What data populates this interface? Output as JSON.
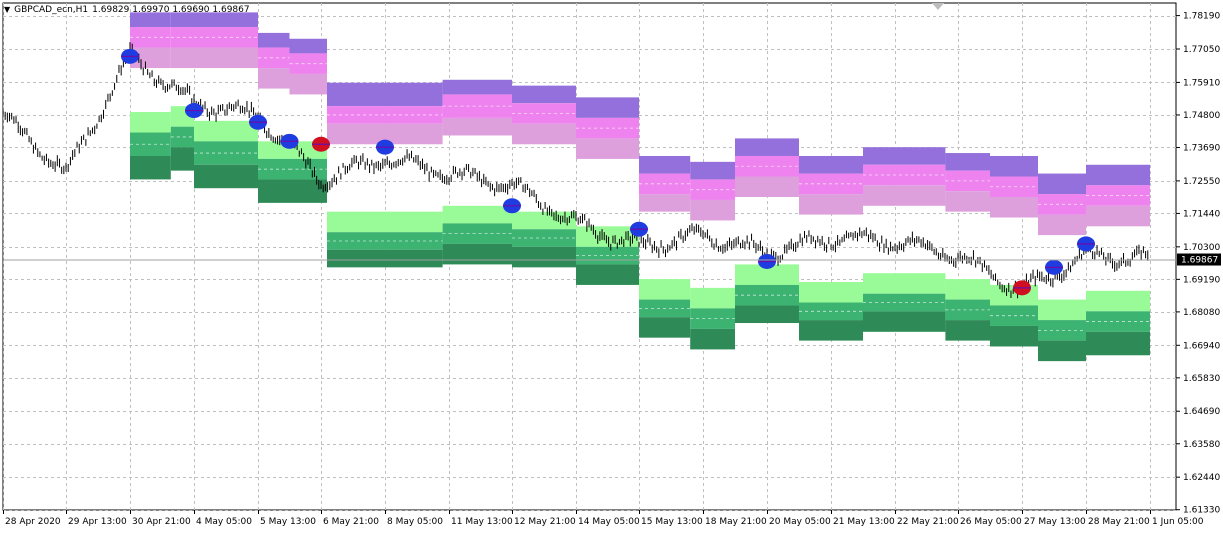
{
  "header": {
    "symbol": "GBPCAD_ecn,H1",
    "ohlc": "1.69829 1.69970 1.69690 1.69867",
    "menu_icon": "triangle-down-icon"
  },
  "chart_data": {
    "type": "candlestick",
    "symbol": "GBPCAD_ecn",
    "timeframe": "H1",
    "ylim": [
      1.6132,
      1.7862
    ],
    "y_ticks": [
      "1.78190",
      "1.77050",
      "1.75910",
      "1.74800",
      "1.73690",
      "1.72550",
      "1.71440",
      "1.70300",
      "1.69190",
      "1.68080",
      "1.66940",
      "1.65830",
      "1.64690",
      "1.63580",
      "1.62440",
      "1.61330"
    ],
    "x_ticks": [
      "28 Apr 2020",
      "29 Apr 13:00",
      "30 Apr 21:00",
      "4 May 05:00",
      "5 May 13:00",
      "6 May 21:00",
      "8 May 05:00",
      "11 May 13:00",
      "12 May 21:00",
      "14 May 05:00",
      "15 May 13:00",
      "18 May 21:00",
      "20 May 05:00",
      "21 May 13:00",
      "22 May 21:00",
      "26 May 05:00",
      "27 May 13:00",
      "28 May 21:00",
      "1 Jun 05:00"
    ],
    "current_price": "1.69867",
    "grid": true,
    "colors": {
      "upper_band_outer": "#9370DB",
      "upper_band_mid": "#EE82EE",
      "upper_band_inner": "#DDA0DD",
      "lower_band_inner": "#98FB98",
      "lower_band_mid": "#3CB371",
      "lower_band_outer": "#2E8B57",
      "price_line": "#000000",
      "signal_buy": "#1E3CE0",
      "signal_sell": "#D01020",
      "grid": "#C0C0C0",
      "current_price_tag": "#000000"
    },
    "price_series": [
      {
        "x": "28 Apr 2020",
        "y": 1.748
      },
      {
        "x": "29 Apr 13:00",
        "y": 1.728
      },
      {
        "x": "30 Apr 21:00",
        "y": 1.768
      },
      {
        "x": "4 May 05:00",
        "y": 1.752
      },
      {
        "x": "5 May 13:00",
        "y": 1.748
      },
      {
        "x": "6 May 21:00",
        "y": 1.726
      },
      {
        "x": "8 May 05:00",
        "y": 1.733
      },
      {
        "x": "11 May 13:00",
        "y": 1.728
      },
      {
        "x": "12 May 21:00",
        "y": 1.724
      },
      {
        "x": "14 May 05:00",
        "y": 1.711
      },
      {
        "x": "15 May 13:00",
        "y": 1.703
      },
      {
        "x": "18 May 21:00",
        "y": 1.707
      },
      {
        "x": "20 May 05:00",
        "y": 1.701
      },
      {
        "x": "21 May 13:00",
        "y": 1.706
      },
      {
        "x": "22 May 21:00",
        "y": 1.705
      },
      {
        "x": "26 May 05:00",
        "y": 1.7
      },
      {
        "x": "27 May 13:00",
        "y": 1.688
      },
      {
        "x": "28 May 21:00",
        "y": 1.7
      },
      {
        "x": "1 Jun 05:00",
        "y": 1.699
      }
    ],
    "zone_blocks": [
      {
        "x_from": "30 Apr 21:00",
        "x_to": "3 May",
        "upper": [
          1.783,
          1.778,
          1.771,
          1.764
        ],
        "lower": [
          1.749,
          1.742,
          1.734,
          1.726
        ]
      },
      {
        "x_from": "3 May",
        "x_to": "4 May 05:00",
        "upper": [
          1.783,
          1.778,
          1.771,
          1.764
        ],
        "lower": [
          1.751,
          1.744,
          1.737,
          1.729
        ]
      },
      {
        "x_from": "4 May 05:00",
        "x_to": "5 May 13:00",
        "upper": [
          1.783,
          1.778,
          1.771,
          1.764
        ],
        "lower": [
          1.746,
          1.739,
          1.731,
          1.723
        ]
      },
      {
        "x_from": "5 May 13:00",
        "x_to": "6 May 05:00",
        "upper": [
          1.776,
          1.771,
          1.764,
          1.757
        ],
        "lower": [
          1.739,
          1.733,
          1.726,
          1.718
        ]
      },
      {
        "x_from": "6 May 05:00",
        "x_to": "7 May",
        "upper": [
          1.774,
          1.769,
          1.762,
          1.755
        ],
        "lower": [
          1.739,
          1.733,
          1.726,
          1.718
        ]
      },
      {
        "x_from": "7 May",
        "x_to": "11 May 05:00",
        "upper": [
          1.759,
          1.751,
          1.745,
          1.738
        ],
        "lower": [
          1.715,
          1.708,
          1.702,
          1.696
        ]
      },
      {
        "x_from": "11 May 05:00",
        "x_to": "12 May 21:00",
        "upper": [
          1.76,
          1.755,
          1.747,
          1.741
        ],
        "lower": [
          1.717,
          1.711,
          1.704,
          1.697
        ]
      },
      {
        "x_from": "12 May 21:00",
        "x_to": "14 May 05:00",
        "upper": [
          1.758,
          1.752,
          1.745,
          1.738
        ],
        "lower": [
          1.715,
          1.709,
          1.703,
          1.696
        ]
      },
      {
        "x_from": "14 May 05:00",
        "x_to": "15 May 13:00",
        "upper": [
          1.754,
          1.747,
          1.74,
          1.733
        ],
        "lower": [
          1.71,
          1.703,
          1.697,
          1.69
        ]
      },
      {
        "x_from": "15 May 13:00",
        "x_to": "18 May 05:00",
        "upper": [
          1.734,
          1.728,
          1.721,
          1.715
        ],
        "lower": [
          1.692,
          1.685,
          1.679,
          1.672
        ]
      },
      {
        "x_from": "18 May 05:00",
        "x_to": "19 May 13:00",
        "upper": [
          1.732,
          1.726,
          1.719,
          1.712
        ],
        "lower": [
          1.689,
          1.682,
          1.675,
          1.668
        ]
      },
      {
        "x_from": "19 May 13:00",
        "x_to": "20 May 21:00",
        "upper": [
          1.74,
          1.734,
          1.727,
          1.72
        ],
        "lower": [
          1.697,
          1.69,
          1.683,
          1.677
        ]
      },
      {
        "x_from": "20 May 21:00",
        "x_to": "22 May 05:00",
        "upper": [
          1.734,
          1.728,
          1.721,
          1.714
        ],
        "lower": [
          1.691,
          1.684,
          1.678,
          1.671
        ]
      },
      {
        "x_from": "22 May 05:00",
        "x_to": "25 May 13:00",
        "upper": [
          1.737,
          1.731,
          1.724,
          1.717
        ],
        "lower": [
          1.694,
          1.687,
          1.681,
          1.674
        ]
      },
      {
        "x_from": "25 May 13:00",
        "x_to": "26 May 21:00",
        "upper": [
          1.735,
          1.729,
          1.722,
          1.715
        ],
        "lower": [
          1.692,
          1.685,
          1.678,
          1.671
        ]
      },
      {
        "x_from": "26 May 21:00",
        "x_to": "27 May 21:00",
        "upper": [
          1.734,
          1.727,
          1.72,
          1.713
        ],
        "lower": [
          1.69,
          1.683,
          1.676,
          1.669
        ]
      },
      {
        "x_from": "27 May 21:00",
        "x_to": "28 May 21:00",
        "upper": [
          1.728,
          1.721,
          1.714,
          1.707
        ],
        "lower": [
          1.685,
          1.678,
          1.671,
          1.664
        ]
      },
      {
        "x_from": "28 May 21:00",
        "x_to": "1 Jun 05:00",
        "upper": [
          1.731,
          1.724,
          1.717,
          1.71
        ],
        "lower": [
          1.688,
          1.681,
          1.674,
          1.666
        ]
      }
    ],
    "signals": [
      {
        "x": "30 Apr 21:00",
        "y": 1.768,
        "type": "buy"
      },
      {
        "x": "4 May 05:00",
        "y": 1.7495,
        "type": "buy"
      },
      {
        "x": "5 May 13:00",
        "y": 1.7455,
        "type": "buy"
      },
      {
        "x": "6 May 05:00",
        "y": 1.739,
        "type": "buy"
      },
      {
        "x": "6 May 21:00",
        "y": 1.738,
        "type": "sell"
      },
      {
        "x": "8 May 05:00",
        "y": 1.737,
        "type": "buy"
      },
      {
        "x": "12 May 21:00",
        "y": 1.717,
        "type": "buy"
      },
      {
        "x": "15 May 13:00",
        "y": 1.709,
        "type": "buy"
      },
      {
        "x": "20 May 05:00",
        "y": 1.698,
        "type": "buy"
      },
      {
        "x": "27 May 13:00",
        "y": 1.689,
        "type": "sell"
      },
      {
        "x": "28 May 05:00",
        "y": 1.696,
        "type": "buy"
      },
      {
        "x": "28 May 21:00",
        "y": 1.704,
        "type": "buy"
      }
    ]
  }
}
